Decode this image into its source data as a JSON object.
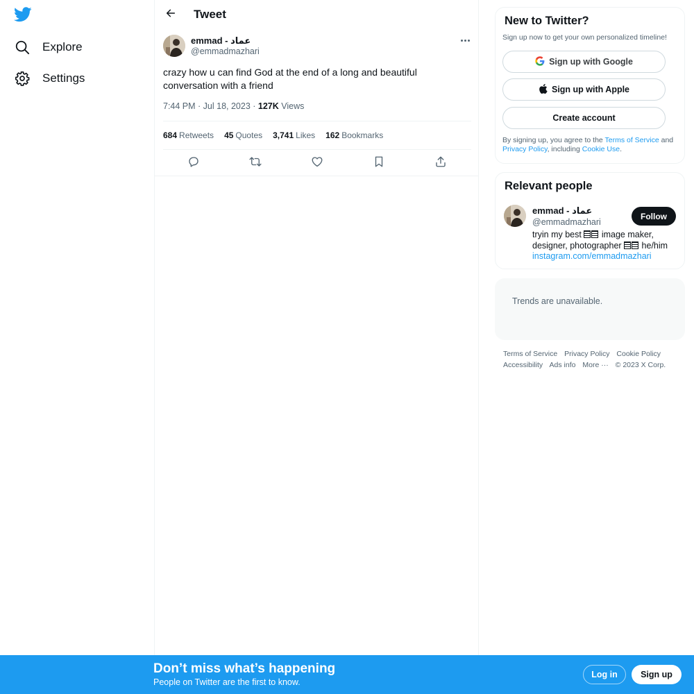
{
  "nav": {
    "logo": "twitter-bird-icon",
    "items": [
      {
        "label": "Explore",
        "icon": "search-icon"
      },
      {
        "label": "Settings",
        "icon": "gear-icon"
      }
    ]
  },
  "header": {
    "title": "Tweet"
  },
  "tweet": {
    "author_name": "emmad - عماد",
    "author_handle": "@emmadmazhari",
    "text": "crazy how u can find God at the end of a long and beautiful conversation with a friend",
    "time": "7:44 PM",
    "date": "Jul 18, 2023",
    "views_count": "127K",
    "views_label": "Views",
    "stats": [
      {
        "count": "684",
        "label": "Retweets"
      },
      {
        "count": "45",
        "label": "Quotes"
      },
      {
        "count": "3,741",
        "label": "Likes"
      },
      {
        "count": "162",
        "label": "Bookmarks"
      }
    ]
  },
  "signup_card": {
    "title": "New to Twitter?",
    "subtitle": "Sign up now to get your own personalized timeline!",
    "google_label": "Sign up with Google",
    "apple_label": "Sign up with Apple",
    "create_label": "Create account",
    "legal_prefix": "By signing up, you agree to the ",
    "terms_link": "Terms of Service",
    "legal_and": " and ",
    "privacy_link": "Privacy Policy",
    "legal_including": ", including ",
    "cookie_link": "Cookie Use",
    "legal_end": "."
  },
  "relevant_people": {
    "title": "Relevant people",
    "name": "emmad - عماد",
    "handle": "@emmadmazhari",
    "follow_label": "Follow",
    "bio_1": "tryin my best",
    "bio_2": "image maker, designer, photographer",
    "bio_3": "he/him",
    "bio_link": "instagram.com/emmadmazhari"
  },
  "trends": {
    "text": "Trends are unavailable."
  },
  "footer": {
    "links": [
      "Terms of Service",
      "Privacy Policy",
      "Cookie Policy",
      "Accessibility",
      "Ads info",
      "More ···"
    ],
    "copyright": "© 2023 X Corp."
  },
  "banner": {
    "title": "Don’t miss what’s happening",
    "subtitle": "People on Twitter are the first to know.",
    "login_label": "Log in",
    "signup_label": "Sign up"
  },
  "colors": {
    "accent": "#1d9bf0",
    "text": "#0f1419",
    "muted": "#536471"
  }
}
